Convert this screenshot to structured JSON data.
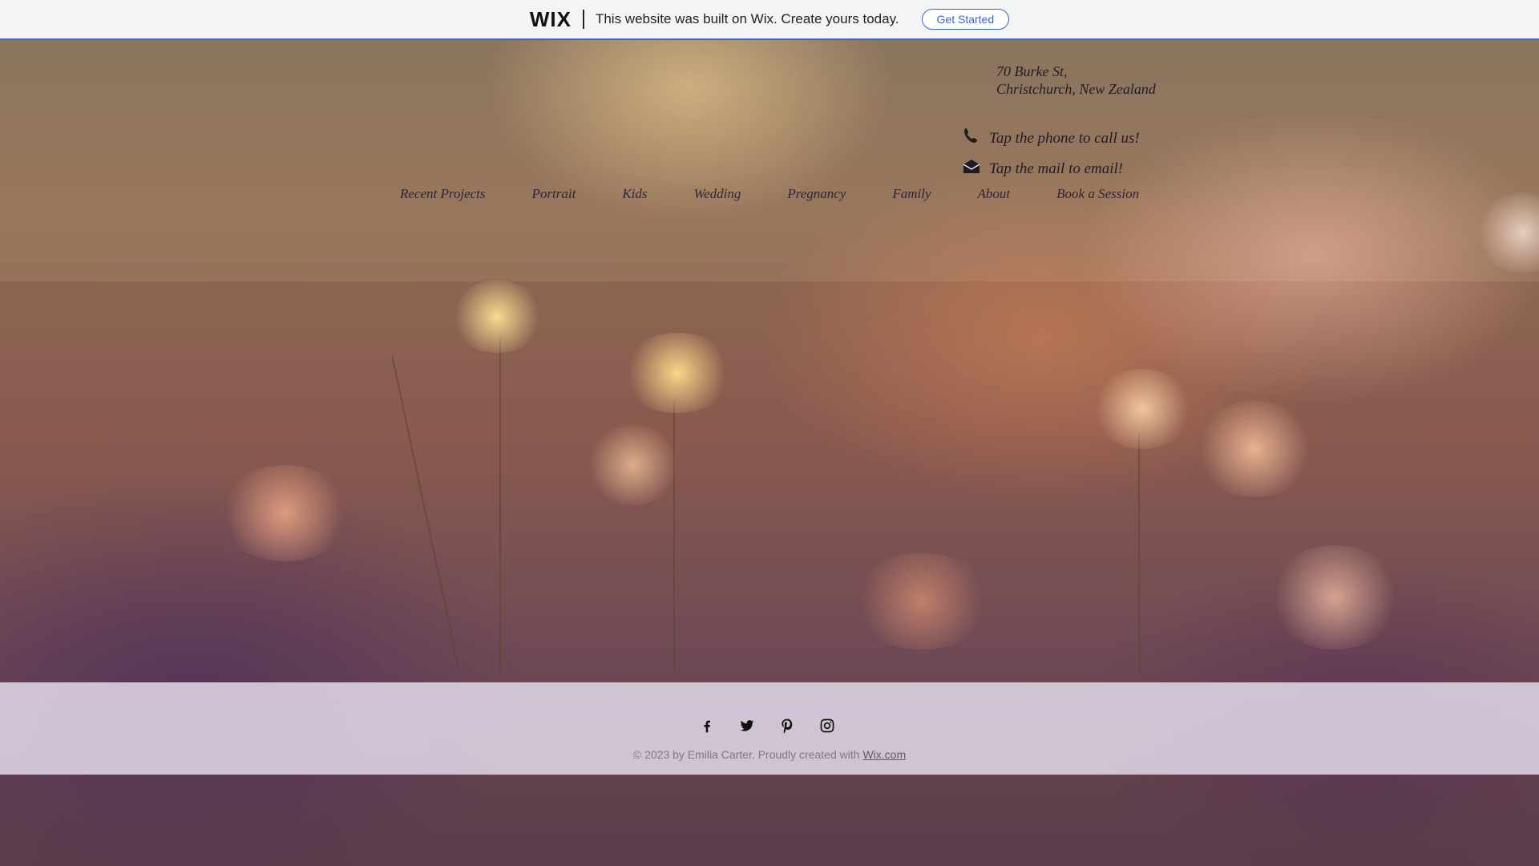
{
  "banner": {
    "logo": "WIX",
    "message": "This website was built on Wix. Create yours today.",
    "cta_label": "Get Started",
    "accent_color": "#3d65c9"
  },
  "contact": {
    "address_line1": "70 Burke St,",
    "address_line2": "Christchurch, New Zealand",
    "phone_text": "Tap the phone to call us!",
    "mail_text": "Tap the mail to email!",
    "phone_icon": "phone-icon",
    "mail_icon": "mail-icon"
  },
  "nav": {
    "items": [
      {
        "label": "Recent Projects"
      },
      {
        "label": "Portrait"
      },
      {
        "label": "Kids"
      },
      {
        "label": "Wedding"
      },
      {
        "label": "Pregnancy"
      },
      {
        "label": "Family"
      },
      {
        "label": "About"
      },
      {
        "label": "Book a Session"
      }
    ]
  },
  "footer": {
    "social_icons": [
      "facebook-icon",
      "twitter-icon",
      "pinterest-icon",
      "instagram-icon"
    ],
    "copyright_prefix": "© 2023 by  Emilia Carter. Proudly created with ",
    "copyright_link": "Wix.com"
  }
}
